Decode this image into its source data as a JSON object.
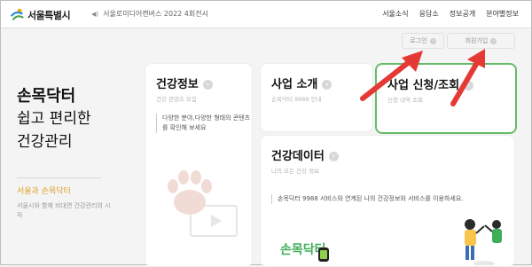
{
  "header": {
    "logo_text": "서울특별시",
    "notice_text": "서울로미디어캔버스 2022 4회전시",
    "nav": [
      "서울소식",
      "응답소",
      "정보공개",
      "분야별정보"
    ]
  },
  "auth": {
    "login_label": "로그인",
    "signup_label": "회원가입"
  },
  "hero": {
    "title": "손목닥터",
    "line2": "쉽고 편리한",
    "line3": "건강관리",
    "sub_title": "서울과 손목닥터",
    "sub_desc": "서울시와 함께 비대면 건강관리의 시작"
  },
  "cards": {
    "health_info": {
      "title": "건강정보",
      "sub": "건강 콘텐츠 모음",
      "body": "다양한 분야,다양한 형태의 콘텐츠를 확인해 보세요"
    },
    "business": {
      "title": "사업 소개",
      "sub": "손목닥터 9988 안내"
    },
    "apply": {
      "title": "사업 신청/조회",
      "sub": "신청 내역 조회"
    },
    "health_data": {
      "title": "건강데이터",
      "sub": "나의 모든 건강 정보",
      "body": "손목닥터 9988 서비스와 연계된 나의 건강정보와 서비스를 이용하세요.",
      "logo_text": "손목닥터"
    }
  },
  "colors": {
    "accent_green": "#66bb6a",
    "hero_sub_orange": "#e0a12a",
    "annotation_red": "#e53935"
  }
}
